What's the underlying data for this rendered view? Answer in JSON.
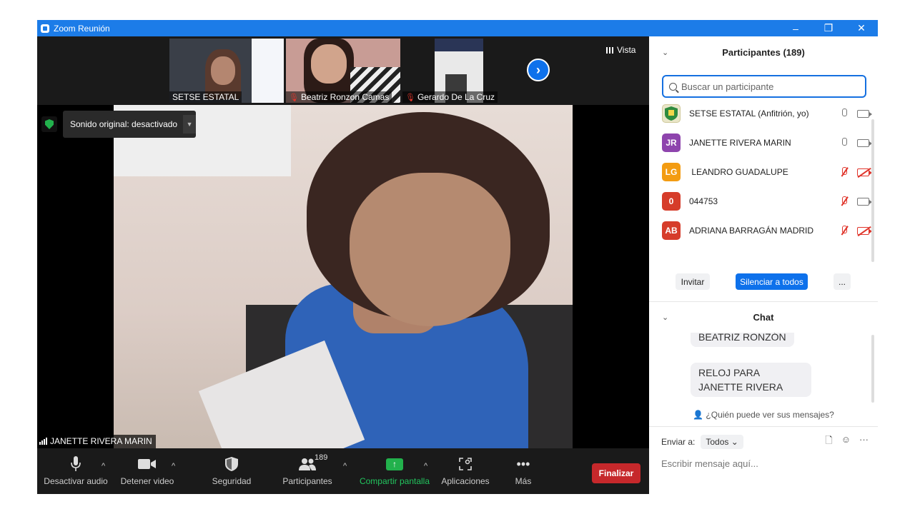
{
  "window": {
    "title": "Zoom Reunión",
    "controls": [
      "–",
      "❐",
      "✕"
    ]
  },
  "strip": {
    "thumbnails": [
      {
        "name": "SETSE ESTATAL",
        "muted": false,
        "bg": "#5b5f6d"
      },
      {
        "name": "Beatriz Ronzon Camas",
        "muted": true,
        "bg": "#c89c95"
      },
      {
        "name": "Gerardo De La Cruz",
        "muted": true,
        "bg": "#8a8c8f"
      }
    ],
    "next_icon": "chevron-right-icon",
    "view_label": "Vista"
  },
  "main_video": {
    "original_sound": "Sonido original: desactivado",
    "speaker_name": "JANETTE RIVERA MARIN"
  },
  "toolbar": {
    "mute_label": "Desactivar audio",
    "video_label": "Detener video",
    "security_label": "Seguridad",
    "participants_label": "Participantes",
    "participants_count": "189",
    "share_label": "Compartir pantalla",
    "apps_label": "Aplicaciones",
    "more_label": "Más",
    "end_label": "Finalizar"
  },
  "participants_panel": {
    "title": "Participantes (189)",
    "search_placeholder": "Buscar un participante",
    "list": [
      {
        "initials": "",
        "name": "SETSE ESTATAL (Anfitrión, yo)",
        "avatar_color": "#e9e6c8",
        "mic_off": false,
        "cam_off": false
      },
      {
        "initials": "JR",
        "name": "JANETTE RIVERA MARIN",
        "avatar_color": "#8e44ad",
        "mic_off": false,
        "cam_off": false
      },
      {
        "initials": "LG",
        "name": " LEANDRO GUADALUPE",
        "avatar_color": "#f39c12",
        "mic_off": true,
        "cam_off": true
      },
      {
        "initials": "0",
        "name": "044753",
        "avatar_color": "#d63c2a",
        "mic_off": true,
        "cam_off": false
      },
      {
        "initials": "AB",
        "name": "ADRIANA BARRAGÁN MADRID",
        "avatar_color": "#d63c2a",
        "mic_off": true,
        "cam_off": true
      }
    ],
    "invite_label": "Invitar",
    "mute_all_label": "Silenciar a todos",
    "more_label": "..."
  },
  "chat_panel": {
    "title": "Chat",
    "messages": [
      "BEATRIZ RONZÓN",
      "RELOJ PARA  JANETTE RIVERA"
    ],
    "who_can_see": "¿Quién puede ver sus mensajes?",
    "send_to_label": "Enviar a:",
    "send_to_value": "Todos",
    "compose_placeholder": "Escribir mensaje aquí..."
  }
}
